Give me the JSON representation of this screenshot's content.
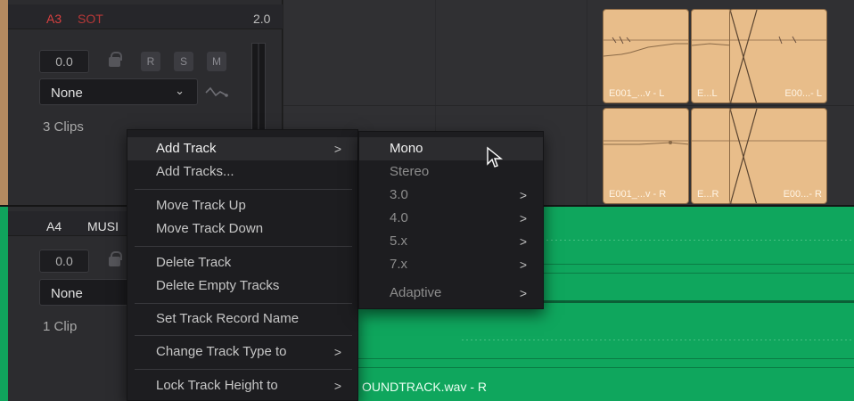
{
  "tracks": {
    "a3": {
      "id": "A3",
      "name": "SOT",
      "format": "2.0",
      "volume": "0.0",
      "buttons": [
        "R",
        "S",
        "M"
      ],
      "effect": "None",
      "clip_count": "3 Clips"
    },
    "a4": {
      "id": "A4",
      "name": "MUSI",
      "volume": "0.0",
      "effect": "None",
      "clip_count": "1 Clip"
    }
  },
  "clips": {
    "a3_l1": "E001_...v - L",
    "a3_l2": "E...L",
    "a3_l3": "E00...- L",
    "a3_r1": "E001_...v - R",
    "a3_r2": "E...R",
    "a3_r3": "E00...- R",
    "a4_name": "OUNDTRACK.wav - R"
  },
  "context_menu": {
    "items": [
      {
        "label": "Add Track",
        "arrow": ">"
      },
      {
        "label": "Add Tracks..."
      },
      {
        "label": "Move Track Up"
      },
      {
        "label": "Move Track Down"
      },
      {
        "label": "Delete Track"
      },
      {
        "label": "Delete Empty Tracks"
      },
      {
        "label": "Set Track Record Name"
      },
      {
        "label": "Change Track Type to",
        "arrow": ">"
      },
      {
        "label": "Lock Track Height to",
        "arrow": ">"
      }
    ]
  },
  "submenu": {
    "items": [
      {
        "label": "Mono"
      },
      {
        "label": "Stereo"
      },
      {
        "label": "3.0",
        "arrow": ">"
      },
      {
        "label": "4.0",
        "arrow": ">"
      },
      {
        "label": "5.x",
        "arrow": ">"
      },
      {
        "label": "7.x",
        "arrow": ">"
      },
      {
        "label": "Adaptive",
        "arrow": ">"
      }
    ]
  },
  "colors": {
    "a3_accent": "#b48a60",
    "a3_id_color": "#d84040",
    "a4_accent": "#10a35c",
    "clip_tan": "#e8bd8a"
  }
}
